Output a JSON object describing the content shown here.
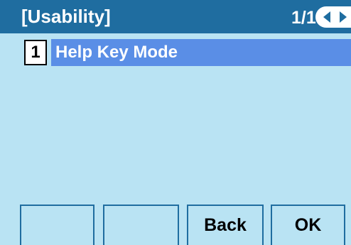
{
  "header": {
    "title": "[Usability]",
    "page_indicator": "1/1",
    "nav_left_icon": "triangle-left",
    "nav_right_icon": "triangle-right"
  },
  "menu": {
    "items": [
      {
        "number": "1",
        "label": "Help Key Mode",
        "selected": true
      }
    ]
  },
  "softkeys": [
    "",
    "",
    "Back",
    "OK"
  ],
  "colors": {
    "header_bg": "#1f6da0",
    "screen_bg": "#b9e3f3",
    "selected_bg": "#5a8ee6"
  }
}
